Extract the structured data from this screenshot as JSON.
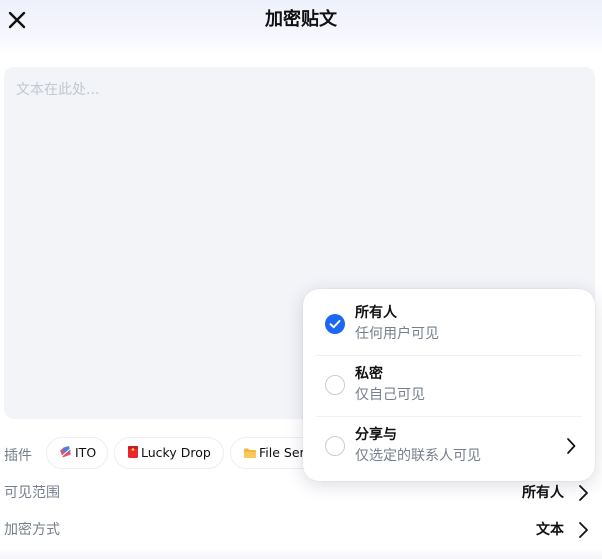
{
  "header": {
    "title": "加密贴文",
    "close_icon": "close-icon"
  },
  "editor": {
    "placeholder": "文本在此处..."
  },
  "plugins": {
    "label": "插件",
    "items": [
      {
        "label": "ITO",
        "icon": "ito-icon"
      },
      {
        "label": "Lucky Drop",
        "icon": "lucky-drop-icon"
      },
      {
        "label": "File Ser",
        "icon": "folder-icon"
      }
    ]
  },
  "visibility": {
    "label": "可见范围",
    "value": "所有人"
  },
  "encryption": {
    "label": "加密方式",
    "value": "文本"
  },
  "visibility_menu": {
    "options": [
      {
        "title": "所有人",
        "description": "任何用户可见",
        "selected": true
      },
      {
        "title": "私密",
        "description": "仅自己可见",
        "selected": false
      },
      {
        "title": "分享与",
        "description": "仅选定的联系人可见",
        "selected": false
      }
    ]
  },
  "colors": {
    "accent": "#1c68f3",
    "text": "#111111",
    "secondary_text": "#767f8d",
    "editor_bg": "#f2f4f8"
  }
}
